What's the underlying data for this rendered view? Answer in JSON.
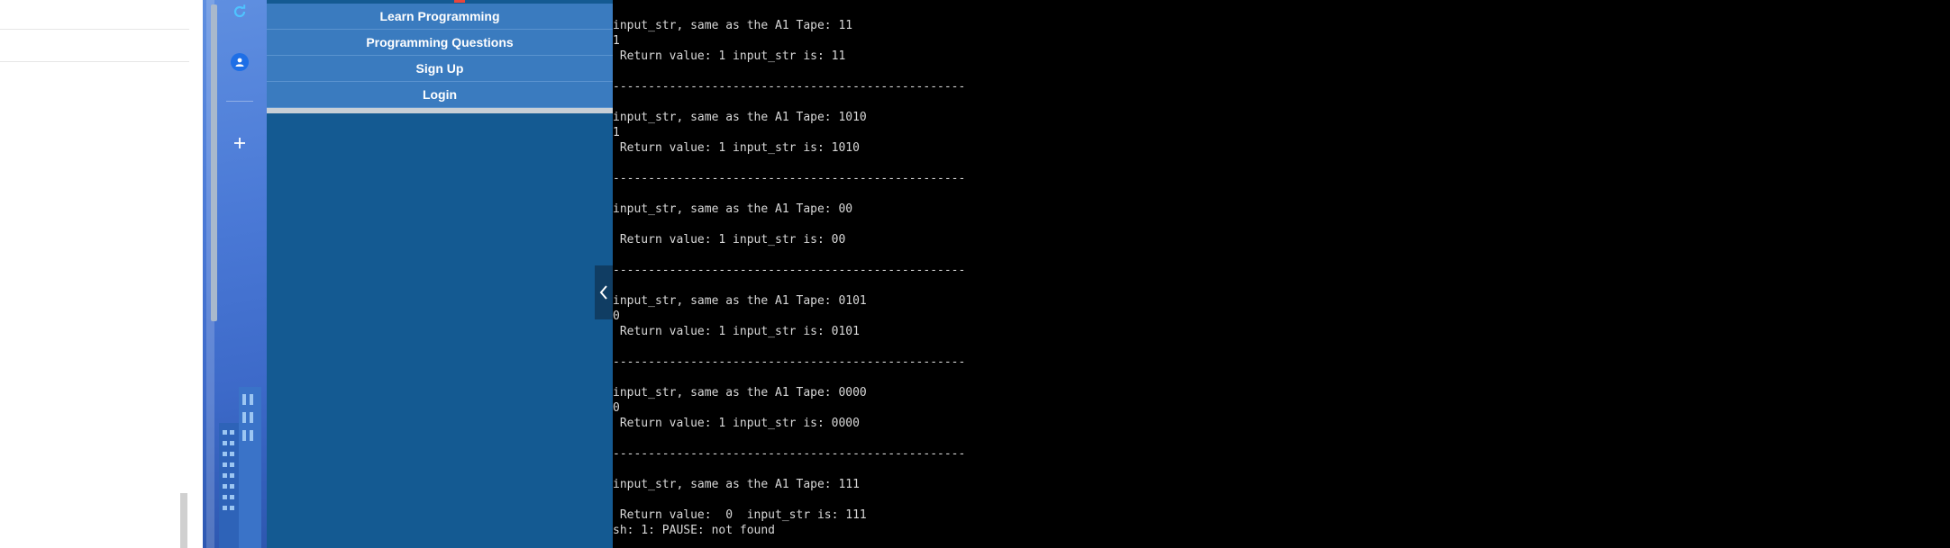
{
  "menu": {
    "items": [
      {
        "label": "Learn Programming"
      },
      {
        "label": "Programming Questions"
      },
      {
        "label": "Sign Up"
      },
      {
        "label": "Login"
      }
    ]
  },
  "console": {
    "lines": [
      "input_str, same as the A1 Tape: 11",
      "1",
      " Return value: 1 input_str is: 11",
      "",
      "--------------------------------------------------",
      "",
      "input_str, same as the A1 Tape: 1010",
      "1",
      " Return value: 1 input_str is: 1010",
      "",
      "--------------------------------------------------",
      "",
      "input_str, same as the A1 Tape: 00",
      "",
      " Return value: 1 input_str is: 00",
      "",
      "--------------------------------------------------",
      "",
      "input_str, same as the A1 Tape: 0101",
      "0",
      " Return value: 1 input_str is: 0101",
      "",
      "--------------------------------------------------",
      "",
      "input_str, same as the A1 Tape: 0000",
      "0",
      " Return value: 1 input_str is: 0000",
      "",
      "--------------------------------------------------",
      "",
      "input_str, same as the A1 Tape: 111",
      "",
      " Return value:  0  input_str is: 111",
      "sh: 1: PAUSE: not found"
    ]
  },
  "icons": {
    "refresh": "refresh-icon",
    "user": "user-icon",
    "add": "plus-icon",
    "collapse": "chevron-left-icon"
  },
  "colors": {
    "menu_bg": "#145a92",
    "menu_item_bg": "#3a7bbf",
    "console_bg": "#000000",
    "console_fg": "#d8d8d8"
  }
}
